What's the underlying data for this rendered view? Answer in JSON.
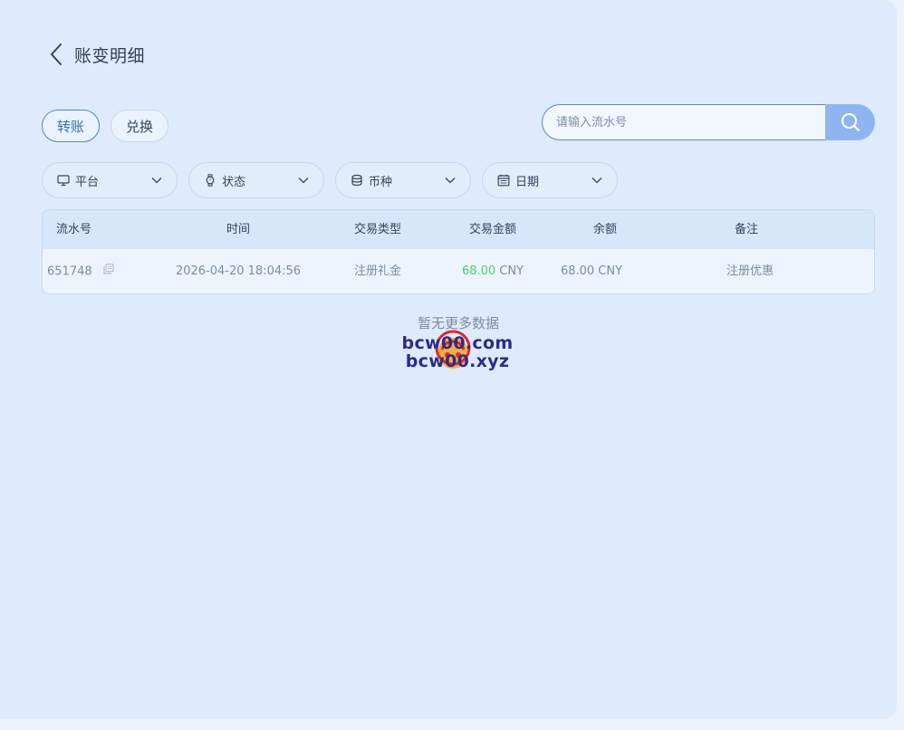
{
  "page": {
    "title": "账变明细"
  },
  "tabs": [
    {
      "label": "转账",
      "active": true
    },
    {
      "label": "兑换",
      "active": false
    }
  ],
  "search": {
    "placeholder": "请输入流水号",
    "value": ""
  },
  "filters": [
    {
      "label": "平台",
      "icon": "monitor-icon"
    },
    {
      "label": "状态",
      "icon": "watch-icon"
    },
    {
      "label": "币种",
      "icon": "coins-stack-icon"
    },
    {
      "label": "日期",
      "icon": "calendar-icon"
    }
  ],
  "table": {
    "columns": [
      "流水号",
      "时间",
      "交易类型",
      "交易金额",
      "余额",
      "备注"
    ],
    "rows": [
      {
        "serial": "651748",
        "time": "2026-04-20 18:04:56",
        "type": "注册礼金",
        "amount": "68.00",
        "amount_currency": "CNY",
        "balance": "68.00 CNY",
        "remark": "注册优惠"
      }
    ]
  },
  "empty_text": "暂无更多数据",
  "watermark": {
    "line1": "bcw00.com",
    "line2": "bcw00.xyz"
  },
  "colors": {
    "accent": "#4f86c6",
    "search_button": "#8fb5f1",
    "amount": "#4fcf6e",
    "background": "#deebfc"
  }
}
